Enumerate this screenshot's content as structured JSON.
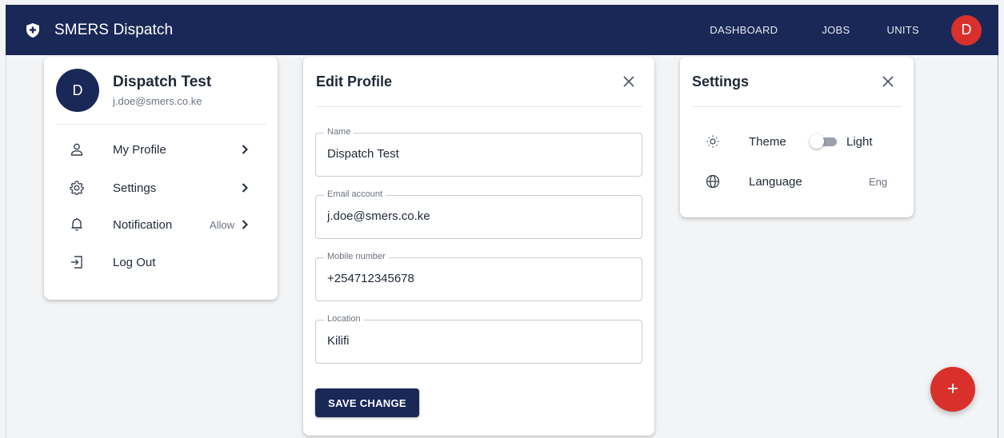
{
  "app": {
    "title": "SMERS Dispatch",
    "icon": "shield-plus-icon"
  },
  "nav": {
    "links": [
      "DASHBOARD",
      "JOBS",
      "UNITS"
    ],
    "avatar_initial": "D"
  },
  "profile_menu": {
    "avatar_initial": "D",
    "name": "Dispatch Test",
    "email": "j.doe@smers.co.ke",
    "items": [
      {
        "label": "My Profile",
        "icon": "user-icon",
        "extra": ""
      },
      {
        "label": "Settings",
        "icon": "gear-icon",
        "extra": ""
      },
      {
        "label": "Notification",
        "icon": "bell-icon",
        "extra": "Allow"
      },
      {
        "label": "Log Out",
        "icon": "logout-icon",
        "extra": ""
      }
    ]
  },
  "edit_profile": {
    "title": "Edit Profile",
    "fields": [
      {
        "label": "Name",
        "value": "Dispatch Test"
      },
      {
        "label": "Email account",
        "value": "j.doe@smers.co.ke"
      },
      {
        "label": "Mobile number",
        "value": "+254712345678"
      },
      {
        "label": "Location",
        "value": "Kilifi"
      }
    ],
    "save_label": "SAVE CHANGE"
  },
  "settings": {
    "title": "Settings",
    "theme_label": "Theme",
    "theme_value": "Light",
    "theme_dark_enabled": false,
    "language_label": "Language",
    "language_value": "Eng"
  },
  "fab": {
    "label": "+"
  },
  "colors": {
    "primary": "#1a2857",
    "accent": "#d9302c",
    "background": "#f3f4f6"
  }
}
